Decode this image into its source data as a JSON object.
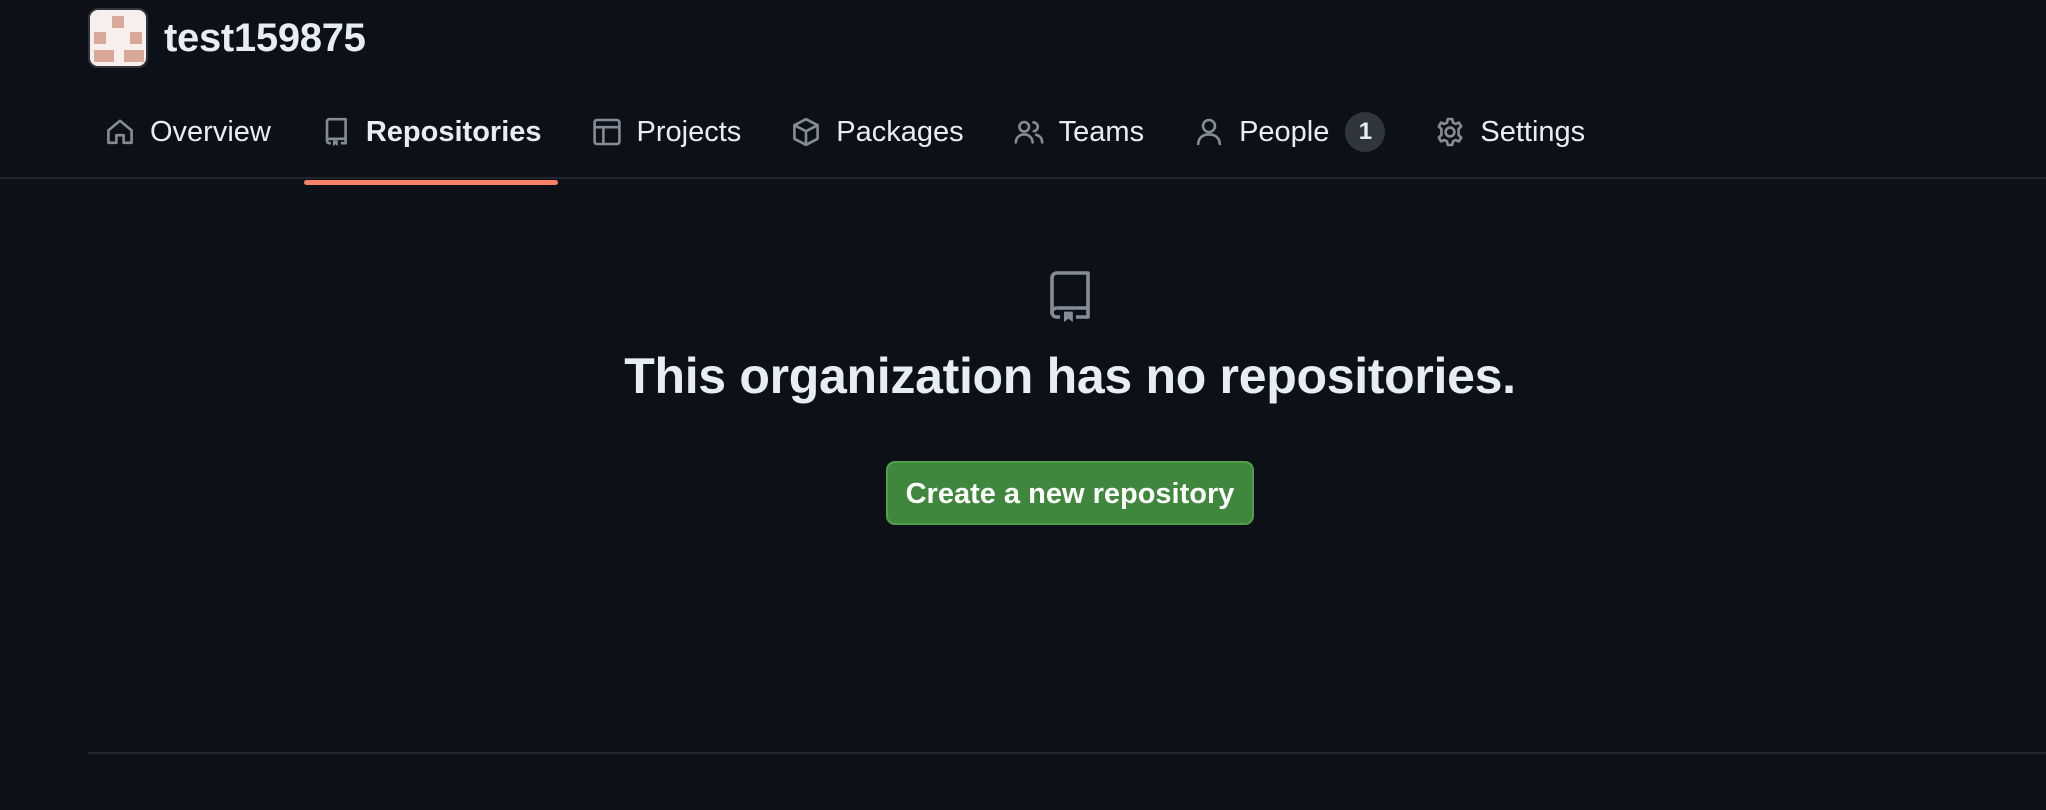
{
  "org": {
    "name": "test159875",
    "avatar_colors": {
      "bg": "#f6efec",
      "pixel": "#d9a89a"
    }
  },
  "nav": {
    "items": [
      {
        "label": "Overview",
        "icon": "home-icon",
        "active": false
      },
      {
        "label": "Repositories",
        "icon": "repo-icon",
        "active": true
      },
      {
        "label": "Projects",
        "icon": "table-icon",
        "active": false
      },
      {
        "label": "Packages",
        "icon": "package-icon",
        "active": false
      },
      {
        "label": "Teams",
        "icon": "people-icon",
        "active": false
      },
      {
        "label": "People",
        "icon": "person-icon",
        "active": false,
        "counter": "1"
      },
      {
        "label": "Settings",
        "icon": "gear-icon",
        "active": false
      }
    ],
    "active_underline_color": "#f78166"
  },
  "blankslate": {
    "icon": "repo-icon",
    "title": "This organization has no repositories.",
    "button_label": "Create a new repository"
  },
  "colors": {
    "background": "#0d1117",
    "text": "#e6edf3",
    "muted_icon": "#848d97",
    "border": "#21262d",
    "primary_button": "#3f873c"
  }
}
